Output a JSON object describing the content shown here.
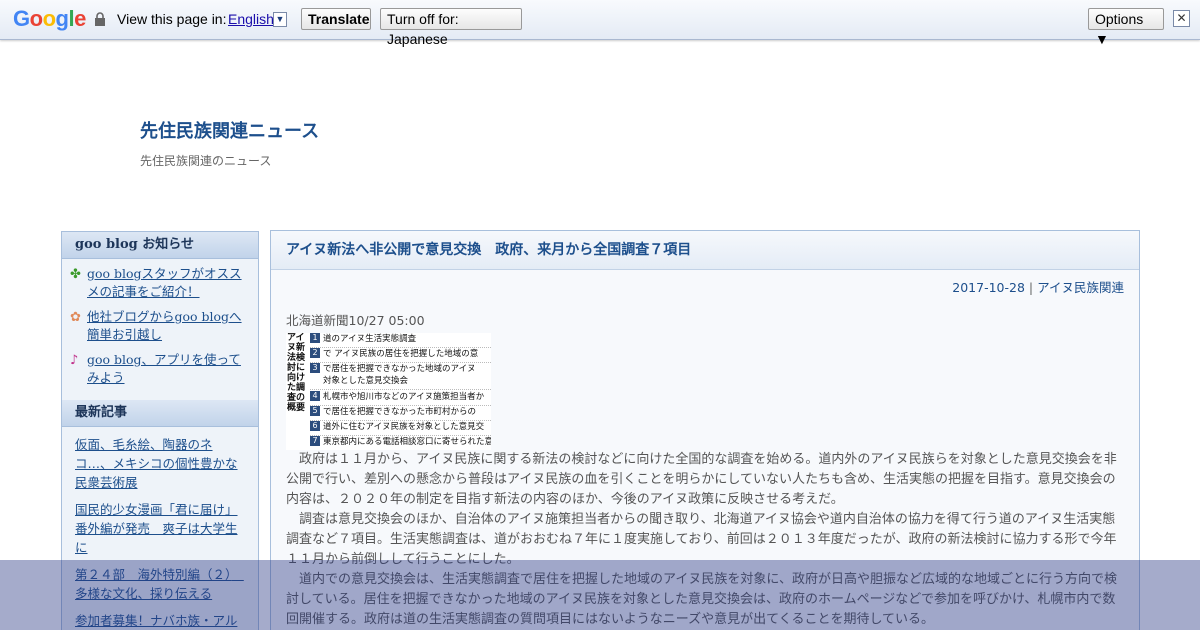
{
  "translate_bar": {
    "logo": "Google",
    "view_text": "View this page in:",
    "language": "English",
    "translate_label": "Translate",
    "turn_off_label": "Turn off for: Japanese",
    "options_label": "Options ▼",
    "close_glyph": "✕"
  },
  "blog": {
    "title": "先住民族関連ニュース",
    "description": "先住民族関連のニュース"
  },
  "sidebar": {
    "notice_heading": "goo blog お知らせ",
    "notices": [
      {
        "icon": "clover-icon",
        "glyph": "🍀",
        "label": "goo blogスタッフがオススメの記事をご紹介！"
      },
      {
        "icon": "flower-icon",
        "glyph": "✿",
        "label": "他社ブログからgoo blogへ簡単お引越し"
      },
      {
        "icon": "music-note-icon",
        "glyph": "♪",
        "label": "goo blog、アプリを使ってみよう"
      }
    ],
    "recent_heading": "最新記事",
    "recent": [
      "仮面、毛糸絵、陶器のネコ…、メキシコの個性豊かな民衆芸術展",
      "国民的少女漫画「君に届け」番外編が発売　爽子は大学生に",
      "第２４部　海外特別編（２）　多様な文化、採り伝える",
      "参加者募集！ナバホ族・アル"
    ]
  },
  "post": {
    "title": "アイヌ新法へ非公開で意見交換　政府、来月から全国調査７項目",
    "date": "2017-10-28",
    "separator": "|",
    "category": "アイヌ民族関連",
    "source": "北海道新聞10/27 05:00",
    "figure": {
      "vertical_title": "アイヌ新法検討に向けた調査の概要",
      "rows": [
        {
          "num": "1",
          "text": "道のアイヌ生活実態調査"
        },
        {
          "num": "2",
          "text": "で アイヌ民族の居住を把握した地域の意"
        },
        {
          "num": "3",
          "text": "で居住を把握できなかった地域のアイヌ"
        },
        {
          "num": "",
          "text": "対象とした意見交換会"
        },
        {
          "num": "4",
          "text": "札幌市や旭川市などのアイヌ施策担当者か"
        },
        {
          "num": "5",
          "text": "で居住を把握できなかった市町村からの"
        },
        {
          "num": "6",
          "text": "道外に住むアイヌ民族を対象とした意見交"
        },
        {
          "num": "7",
          "text": "東京都内にある電話相談窓口に寄せられた意"
        }
      ]
    },
    "paragraphs": [
      "政府は１１月から、アイヌ民族に関する新法の検討などに向けた全国的な調査を始める。道内外のアイヌ民族らを対象とした意見交換会を非公開で行い、差別への懸念から普段はアイヌ民族の血を引くことを明らかにしていない人たちも含め、生活実態の把握を目指す。意見交換会の内容は、２０２０年の制定を目指す新法の内容のほか、今後のアイヌ政策に反映させる考えだ。",
      "調査は意見交換会のほか、自治体のアイヌ施策担当者からの聞き取り、北海道アイヌ協会や道内自治体の協力を得て行う道のアイヌ生活実態調査など７項目。生活実態調査は、道がおおむね７年に１度実施しており、前回は２０１３年度だったが、政府の新法検討に協力する形で今年１１月から前倒しして行うことにした。",
      "道内での意見交換会は、生活実態調査で居住を把握した地域のアイヌ民族を対象に、政府が日高や胆振など広域的な地域ごとに行う方向で検討している。居住を把握できなかった地域のアイヌ民族を対象とした意見交換会は、政府のホームページなどで参加を呼びかけ、札幌市内で数回開催する。政府は道の生活実態調査の質問項目にはないようなニーズや意見が出てくることを期待している。"
    ]
  },
  "colors": {
    "link": "#1d4f8c",
    "overlay": "#283782"
  }
}
